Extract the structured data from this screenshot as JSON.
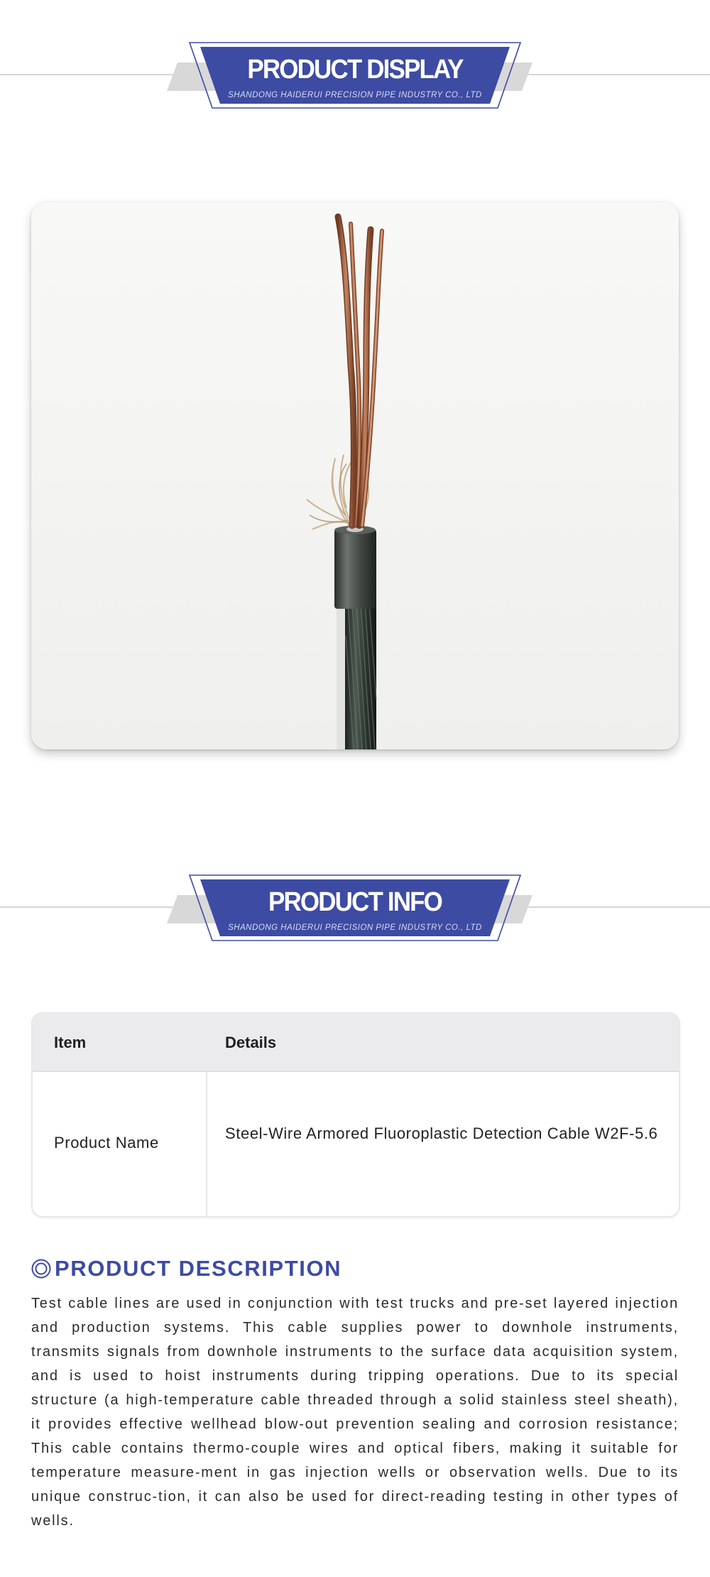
{
  "banners": {
    "display": {
      "title": "PRODUCT DISPLAY",
      "subtitle": "SHANDONG HAIDERUI PRECISION PIPE INDUSTRY CO., LTD"
    },
    "info": {
      "title": "PRODUCT INFO",
      "subtitle": "SHANDONG HAIDERUI PRECISION PIPE INDUSTRY CO., LTD"
    }
  },
  "product_image": {
    "subject": "steel-wire armored cable with exposed copper wires"
  },
  "info_table": {
    "headers": {
      "item": "Item",
      "details": "Details"
    },
    "rows": [
      {
        "item": "Product Name",
        "details": "Steel-Wire Armored Fluoroplastic Detection Cable W2F-5.6"
      }
    ]
  },
  "description": {
    "heading": "PRODUCT DESCRIPTION",
    "body": "Test cable lines are used in conjunction with test trucks and pre-set layered injection and production systems. This cable supplies power to downhole instruments, transmits signals from downhole instruments to the surface data acquisition system, and is used to hoist instruments during tripping operations. Due to its special structure (a high-temperature cable threaded through a solid stainless steel sheath), it provides effective wellhead blow-out prevention sealing and corrosion resistance; This cable contains thermo-couple wires and optical fibers, making it suitable for temperature measure-ment in gas injection wells or observation wells. Due to its unique construc-tion, it can also be used for direct-reading testing in other types of wells."
  },
  "colors": {
    "brand_blue": "#3d4ba3",
    "banner_gray": "#d8d8d8",
    "table_header_bg": "#ebebed"
  },
  "icons": {
    "heading_icon": "double-ring-icon"
  }
}
